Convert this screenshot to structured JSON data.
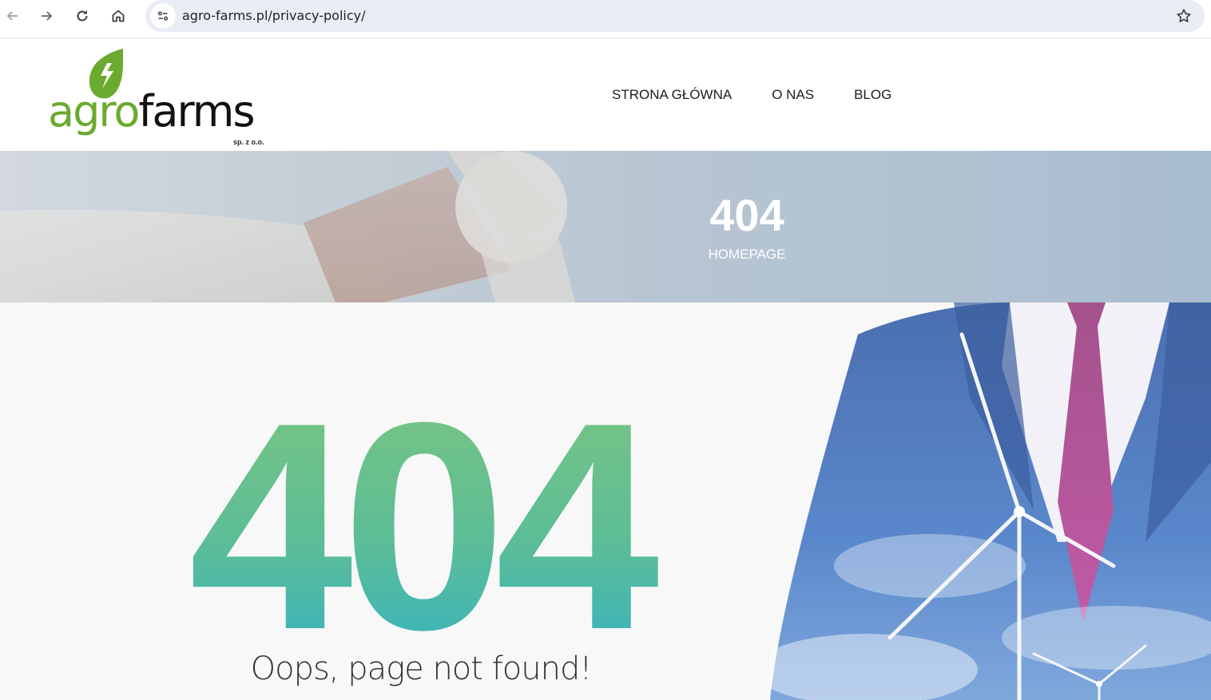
{
  "browser": {
    "url": "agro-farms.pl/privacy-policy/",
    "icons": [
      "back-arrow-icon",
      "forward-arrow-icon",
      "reload-icon",
      "home-icon",
      "site-info-icon",
      "bookmark-star-icon"
    ]
  },
  "header": {
    "logo": {
      "part1": "agro",
      "part2": "farms",
      "suffix": "sp. z o.o."
    },
    "nav": [
      "STRONA GŁÓWNA",
      "O NAS",
      "BLOG"
    ]
  },
  "hero": {
    "title": "404",
    "breadcrumb": "HOMEPAGE"
  },
  "main": {
    "code": "404",
    "message": "Oops, page not found!"
  },
  "colors": {
    "brand_green": "#6aaa2e",
    "gradient_top": "#7dc67e",
    "gradient_bottom": "#2fb0c8"
  }
}
